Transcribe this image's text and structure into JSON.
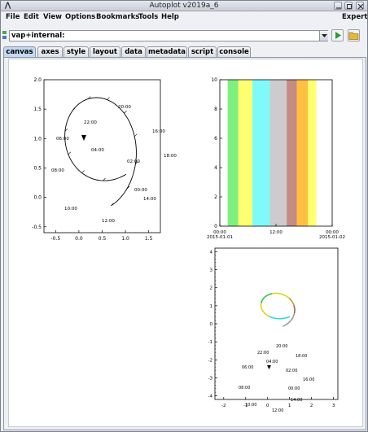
{
  "window": {
    "title": "Autoplot v2019a_6"
  },
  "menubar": {
    "items": [
      "File",
      "Edit",
      "View",
      "Options",
      "Bookmarks",
      "Tools",
      "Help"
    ],
    "expert": "Expert"
  },
  "address": {
    "value": "vap+internal:"
  },
  "tabs": [
    "canvas",
    "axes",
    "style",
    "layout",
    "data",
    "metadata",
    "script",
    "console"
  ],
  "plots": {
    "orbit": {
      "type": "line",
      "x_ticks": [
        "-0.5",
        "0.0",
        "0.5",
        "1.0",
        "1.5"
      ],
      "y_ticks": [
        "2.0",
        "1.5",
        "1.0",
        "0.5",
        "0.0",
        "-0.5"
      ],
      "xlim": [
        -0.75,
        1.75
      ],
      "ylim": [
        -0.6,
        2.0
      ],
      "time_labels": [
        "00:00",
        "02:00",
        "04:00",
        "06:00",
        "08:00",
        "10:00",
        "12:00",
        "14:00",
        "16:00",
        "18:00",
        "20:00",
        "22:00"
      ]
    },
    "spectrogram": {
      "y_ticks": [
        "10",
        "8",
        "6",
        "4",
        "2",
        "0"
      ],
      "x_ticks": [
        "00:00",
        "12:00",
        "00:00"
      ],
      "x_dates": [
        "2015-01-01",
        "2015-01-02"
      ],
      "band_colors": [
        "#ffffff",
        "#7ef07e",
        "#ffff70",
        "#7efafa",
        "#cccccc",
        "#c48c84",
        "#ffc040",
        "#ffff70",
        "#ffffff"
      ]
    },
    "colored_orbit": {
      "x_ticks": [
        "-2",
        "-1",
        "0",
        "1",
        "2",
        "3"
      ],
      "y_ticks": [
        "4",
        "3",
        "2",
        "1",
        "0",
        "-1",
        "-2",
        "-3",
        "-4"
      ],
      "time_labels": [
        "00:00",
        "02:00",
        "04:00",
        "06:00",
        "08:00",
        "10:00",
        "12:00",
        "14:00",
        "16:00",
        "18:00",
        "20:00",
        "22:00"
      ]
    }
  }
}
